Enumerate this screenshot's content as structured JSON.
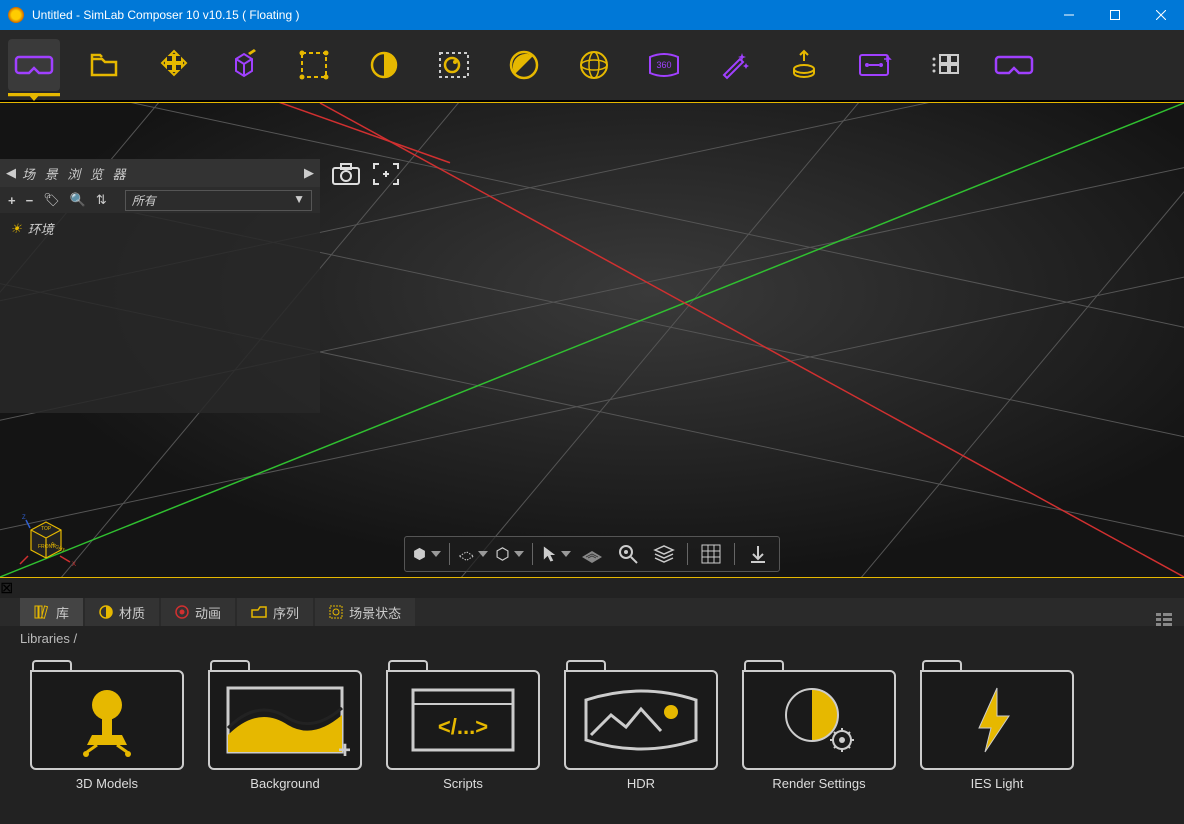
{
  "window": {
    "title": "Untitled - SimLab Composer 10 v10.15 ( Floating )"
  },
  "scene_panel": {
    "title": "场 景 浏 览 器",
    "filter_label": "所有",
    "tree": [
      {
        "label": "环境"
      }
    ]
  },
  "lower": {
    "tabs": [
      {
        "label": "库",
        "active": true
      },
      {
        "label": "材质"
      },
      {
        "label": "动画"
      },
      {
        "label": "序列"
      },
      {
        "label": "场景状态"
      }
    ],
    "breadcrumb": "Libraries  /",
    "cards": [
      {
        "label": "3D Models"
      },
      {
        "label": "Background"
      },
      {
        "label": "Scripts"
      },
      {
        "label": "HDR"
      },
      {
        "label": "Render Settings"
      },
      {
        "label": "IES Light"
      }
    ]
  },
  "colors": {
    "accent_purple": "#a040ff",
    "accent_yellow": "#e6b800",
    "axis_red": "#d03030",
    "axis_green": "#30c030"
  }
}
